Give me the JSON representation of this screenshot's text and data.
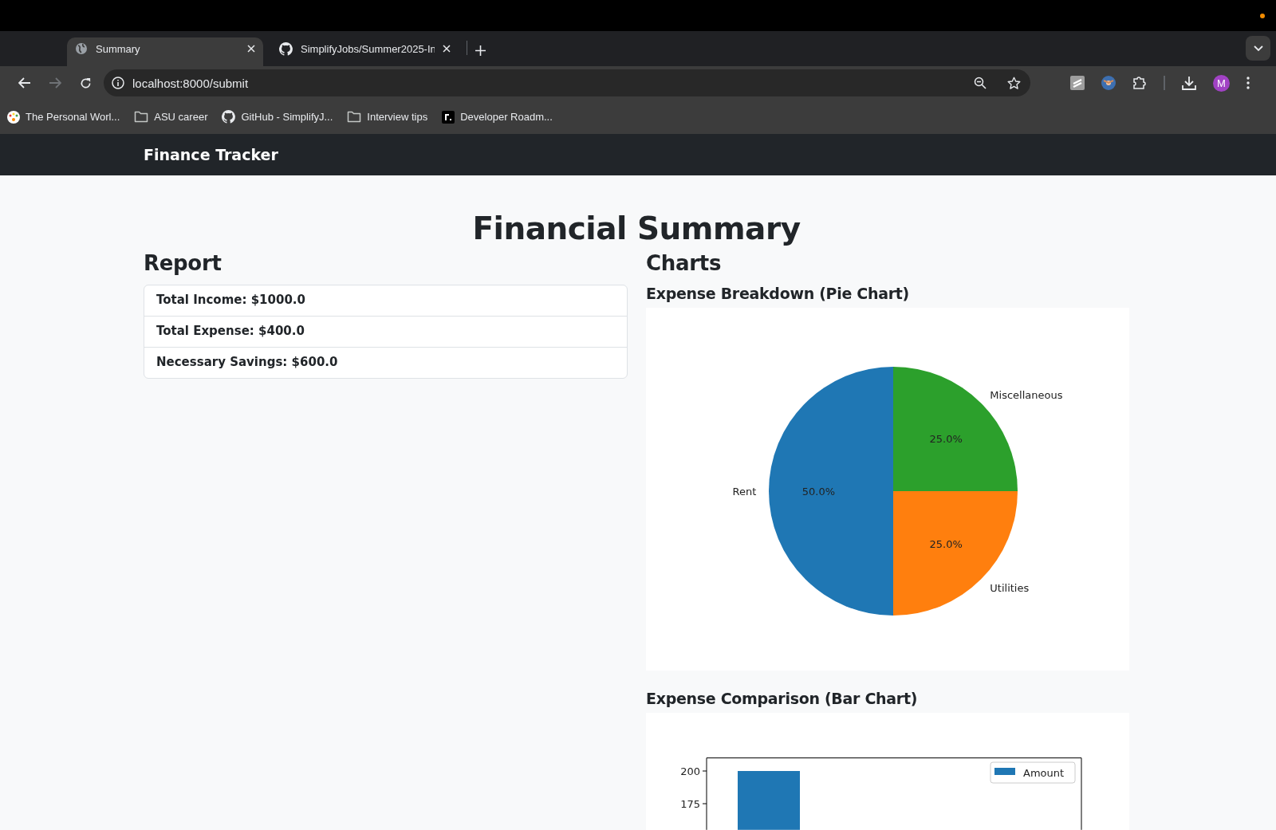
{
  "browser": {
    "tabs": [
      {
        "title": "Summary",
        "kind": "page",
        "selected": true
      },
      {
        "title": "SimplifyJobs/Summer2025-In",
        "kind": "repo",
        "selected": false
      }
    ],
    "forward_disabled": true,
    "address": "localhost:8000/submit",
    "profile": "M",
    "bookmarks": [
      {
        "title": "The Personal Worl...",
        "kind": "site"
      },
      {
        "title": "ASU career",
        "kind": "folder"
      },
      {
        "title": "GitHub - SimplifyJ...",
        "kind": "repo"
      },
      {
        "title": "Interview tips",
        "kind": "folder"
      },
      {
        "title": "Developer Roadm...",
        "kind": "roadmap"
      }
    ]
  },
  "navbar": {
    "brand": "Finance Tracker"
  },
  "page_title": "Financial Summary",
  "report": {
    "heading": "Report",
    "items": [
      "Total Income: $1000.0",
      "Total Expense: $400.0",
      "Necessary Savings: $600.0"
    ]
  },
  "charts": {
    "heading": "Charts",
    "pie": {
      "title": "Expense Breakdown (Pie Chart)",
      "chart_data": {
        "type": "pie",
        "categories": [
          "Rent",
          "Utilities",
          "Miscellaneous"
        ],
        "series": [
          {
            "colors": [
              "#1f77b4",
              "#ff7f0e",
              "#2ca02c"
            ],
            "values": [
              50,
              25,
              25
            ]
          }
        ],
        "value_labels": [
          "50.0%",
          "25.0%",
          "25.0%"
        ]
      }
    },
    "bar": {
      "title": "Expense Comparison (Bar Chart)",
      "chart_data": {
        "type": "bar",
        "ylim": [
          155,
          210
        ],
        "yticks": [
          175,
          200
        ],
        "series": [
          {
            "name": "Amount",
            "color": "#1f77b4",
            "values": [
              200
            ]
          }
        ]
      }
    }
  }
}
